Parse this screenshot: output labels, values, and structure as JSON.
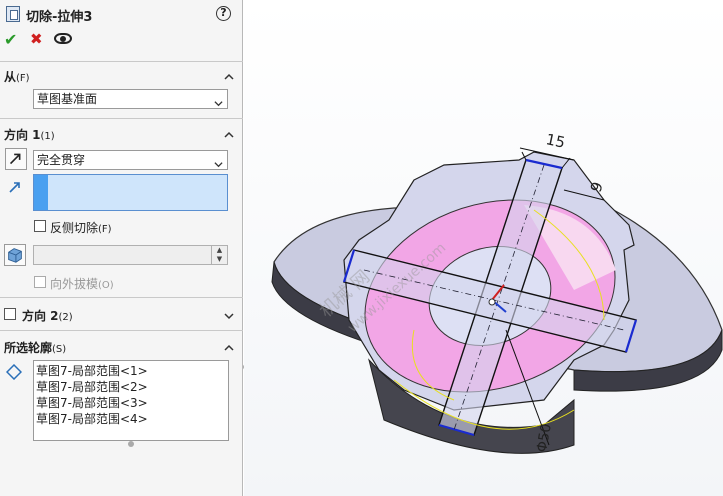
{
  "header": {
    "title": "切除-拉伸3",
    "help": "?"
  },
  "from": {
    "heading": "从",
    "key": "(F)",
    "value": "草图基准面"
  },
  "direction1": {
    "heading": "方向 1",
    "key": "(1)",
    "end_condition": "完全贯穿",
    "flip_side_label": "反侧切除",
    "flip_side_key": "(F)",
    "draft_outward_label": "向外拔模",
    "draft_outward_key": "(O)"
  },
  "direction2": {
    "heading": "方向 2",
    "key": "(2)"
  },
  "contours": {
    "heading": "所选轮廓",
    "key": "(S)",
    "items": [
      "草图7-局部范围<1>",
      "草图7-局部范围<2>",
      "草图7-局部范围<3>",
      "草图7-局部范围<4>"
    ]
  },
  "dimensions": {
    "width": "15",
    "depth": "9",
    "diameter": "Φ50"
  },
  "watermark": {
    "cn": "机械 网",
    "url": "www.jixiexue.com"
  },
  "colors": {
    "ok": "#2a9a2a",
    "cancel": "#d02020",
    "selection": "#cfe5fb",
    "highlight_face": "#f2a6e6"
  }
}
